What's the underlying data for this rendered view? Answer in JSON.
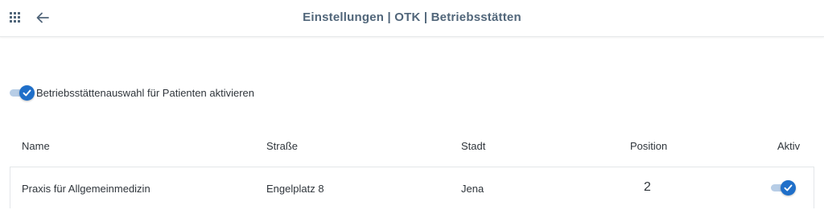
{
  "header": {
    "title": "Einstellungen | OTK | Betriebsstätten",
    "apps_icon": "apps-grid-icon",
    "back_icon": "arrow-left-icon"
  },
  "setting": {
    "label": "Betriebsstättenauswahl für Patienten aktivieren",
    "enabled": true
  },
  "table": {
    "columns": [
      "Name",
      "Straße",
      "Stadt",
      "Position",
      "Aktiv"
    ],
    "rows": [
      {
        "name": "Praxis für Allgemeinmedizin",
        "street": "Engelplatz 8",
        "city": "Jena",
        "position": "2",
        "active": true
      }
    ]
  },
  "colors": {
    "accent": "#1f6fc9",
    "toggle_track": "#b7cde6",
    "title": "#51667a"
  }
}
